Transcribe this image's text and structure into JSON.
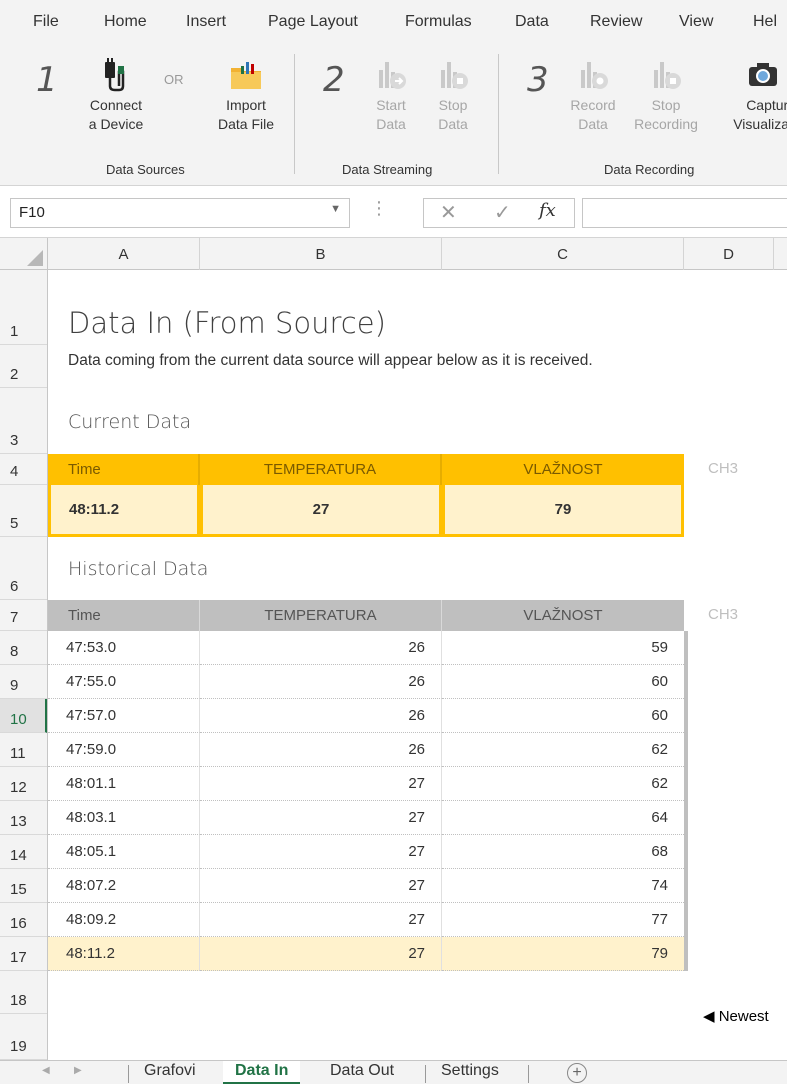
{
  "ribbon": {
    "tabs": [
      "File",
      "Home",
      "Insert",
      "Page Layout",
      "Formulas",
      "Data",
      "Review",
      "View",
      "Hel"
    ],
    "or_text": "OR",
    "steps": [
      "1",
      "2",
      "3"
    ],
    "groups": {
      "sources": {
        "label": "Data Sources",
        "connect": [
          "Connect",
          "a Device"
        ],
        "import": [
          "Import",
          "Data File"
        ]
      },
      "streaming": {
        "label": "Data Streaming",
        "start": [
          "Start",
          "Data"
        ],
        "stop": [
          "Stop",
          "Data"
        ]
      },
      "recording": {
        "label": "Data Recording",
        "record": [
          "Record",
          "Data"
        ],
        "stop": [
          "Stop",
          "Recording"
        ],
        "capture": [
          "Capture",
          "Visualizati"
        ]
      }
    }
  },
  "formula_bar": {
    "name_box": "F10",
    "cancel_glyph": "✕",
    "enter_glyph": "✓",
    "fx": "fx",
    "value": ""
  },
  "columns": [
    "A",
    "B",
    "C",
    "D"
  ],
  "rows": [
    "1",
    "2",
    "3",
    "4",
    "5",
    "6",
    "7",
    "8",
    "9",
    "10",
    "11",
    "12",
    "13",
    "14",
    "15",
    "16",
    "17",
    "18",
    "19"
  ],
  "active_row": "10",
  "sheet": {
    "title": "Data In (From Source)",
    "subtitle": "Data coming from the current data source will appear below as it is received.",
    "current": {
      "heading": "Current Data",
      "headers": [
        "Time",
        "TEMPERATURA",
        "VLAŽNOST"
      ],
      "extra_header": "CH3",
      "values": [
        "48:11.2",
        "27",
        "79"
      ]
    },
    "historical": {
      "heading": "Historical Data",
      "headers": [
        "Time",
        "TEMPERATURA",
        "VLAŽNOST"
      ],
      "extra_header": "CH3",
      "rows": [
        [
          "47:53.0",
          "26",
          "59"
        ],
        [
          "47:55.0",
          "26",
          "60"
        ],
        [
          "47:57.0",
          "26",
          "60"
        ],
        [
          "47:59.0",
          "26",
          "62"
        ],
        [
          "48:01.1",
          "27",
          "62"
        ],
        [
          "48:03.1",
          "27",
          "64"
        ],
        [
          "48:05.1",
          "27",
          "68"
        ],
        [
          "48:07.2",
          "27",
          "74"
        ],
        [
          "48:09.2",
          "27",
          "77"
        ],
        [
          "48:11.2",
          "27",
          "79"
        ]
      ]
    },
    "newest_label": "◀ Newest"
  },
  "sheet_tabs": {
    "tabs": [
      "Grafovi",
      "Data In",
      "Data Out",
      "Settings"
    ],
    "active": "Data In",
    "add_glyph": "+"
  },
  "colors": {
    "accent_green": "#217346",
    "current_header": "#ffc000",
    "current_value": "#fff2cc",
    "historical_header": "#bfbfbf"
  }
}
